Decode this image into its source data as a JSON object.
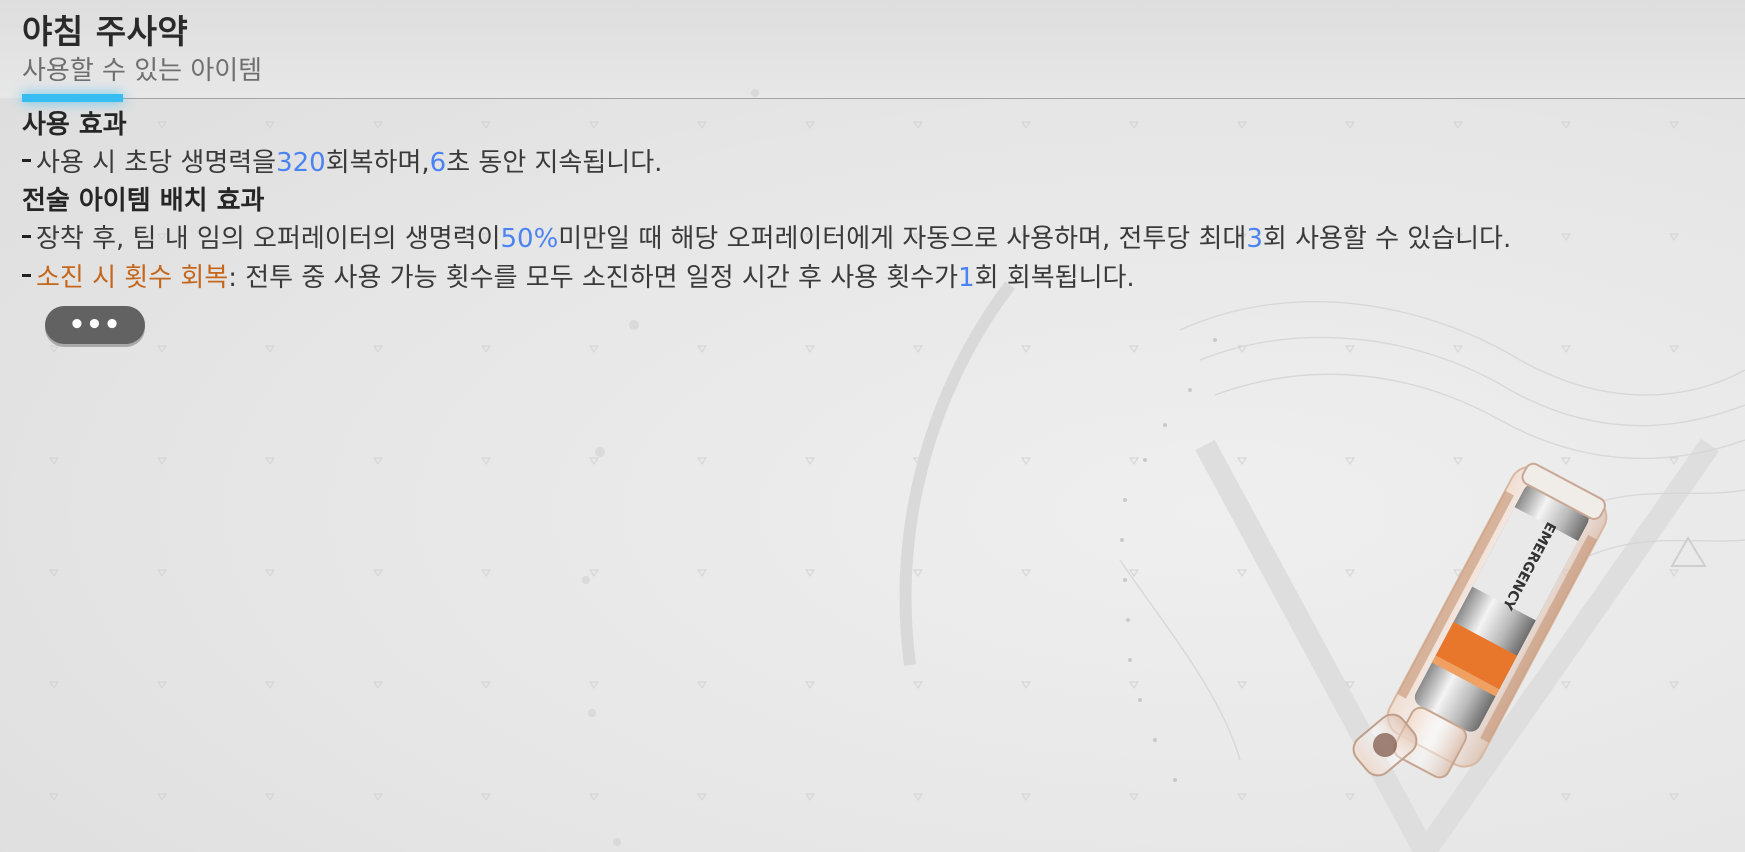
{
  "item": {
    "title": "야침 주사약",
    "type": "사용할 수 있는 아이템"
  },
  "use_effect": {
    "heading": "사용 효과",
    "line1": {
      "pre": "사용 시 초당 생명력을 ",
      "value1": "320",
      "mid": " 회복하며, ",
      "value2": "6",
      "post": "초 동안 지속됩니다."
    }
  },
  "tactical_effect": {
    "heading": "전술 아이템 배치 효과",
    "line1": {
      "pre": "장착 후, 팀 내 임의 오퍼레이터의 생명력이 ",
      "value1": "50%",
      "mid": " 미만일 때 해당 오퍼레이터에게 자동으로 사용하며, 전투당 최대 ",
      "value2": "3",
      "post": "회 사용할 수 있습니다."
    },
    "line2": {
      "keyword": "소진 시 횟수 회복",
      "pre": ": 전투 중 사용 가능 횟수를 모두 소진하면 일정 시간 후 사용 횟수가 ",
      "value1": "1",
      "post": "회 회복됩니다."
    }
  },
  "more_button": {
    "label": "•••"
  },
  "image": {
    "label_text": "EMERGENCY",
    "icon": "injector-canister-icon"
  },
  "colors": {
    "accent": "#38bdf2",
    "value_highlight": "#4b83f2",
    "keyword_highlight": "#c4661b",
    "button": "#626262"
  }
}
